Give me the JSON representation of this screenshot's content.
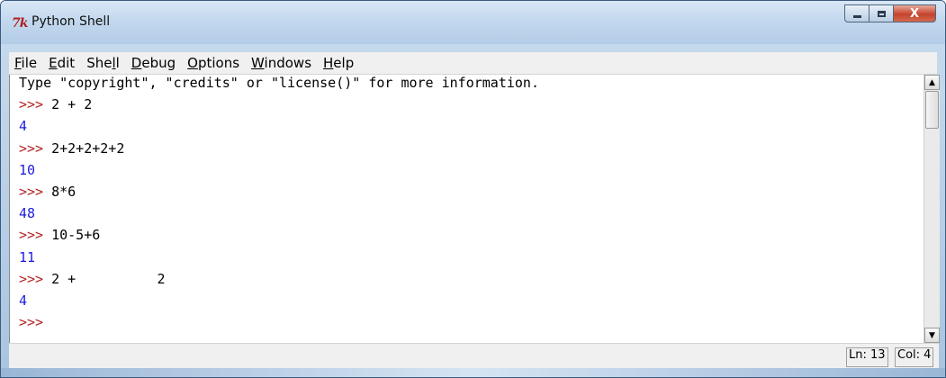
{
  "window": {
    "title": "Python Shell",
    "icon_text": "7k",
    "minimize_symbol": "",
    "maximize_symbol": "",
    "close_symbol": "X"
  },
  "menu": {
    "items": [
      {
        "label": "File"
      },
      {
        "label": "Edit"
      },
      {
        "label": "Shell"
      },
      {
        "label": "Debug"
      },
      {
        "label": "Options"
      },
      {
        "label": "Windows"
      },
      {
        "label": "Help"
      }
    ]
  },
  "shell": {
    "info_line": "Type \"copyright\", \"credits\" or \"license()\" for more information.",
    "prompt": ">>>",
    "lines": [
      {
        "kind": "input",
        "code": "2 + 2"
      },
      {
        "kind": "output",
        "text": "4"
      },
      {
        "kind": "input",
        "code": "2+2+2+2+2"
      },
      {
        "kind": "output",
        "text": "10"
      },
      {
        "kind": "input",
        "code": "8*6"
      },
      {
        "kind": "output",
        "text": "48"
      },
      {
        "kind": "input",
        "code": "10-5+6"
      },
      {
        "kind": "output",
        "text": "11"
      },
      {
        "kind": "input",
        "code": "2 +          2"
      },
      {
        "kind": "output",
        "text": "4"
      },
      {
        "kind": "input",
        "code": ""
      }
    ]
  },
  "scrollbar": {
    "up_arrow": "▲",
    "down_arrow": "▼"
  },
  "status": {
    "line": "Ln: 13",
    "col": "Col: 4"
  },
  "colors": {
    "prompt": "#b22222",
    "output": "#1c1cdc",
    "input": "#000000"
  }
}
